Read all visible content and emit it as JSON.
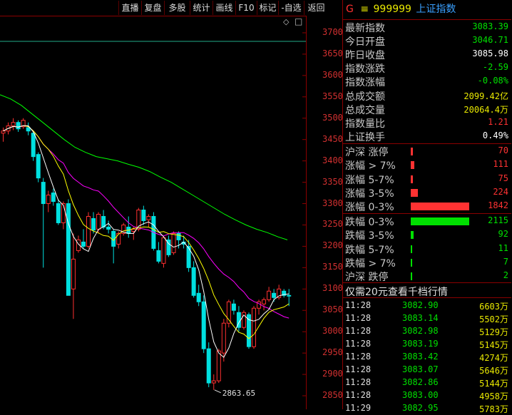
{
  "toolbar": {
    "buttons": [
      "直播",
      "复盘",
      "多股",
      "统计",
      "画线",
      "F10",
      "标记",
      "-自选",
      "返回"
    ]
  },
  "header": {
    "g_label": "G",
    "menu_glyph": "≡",
    "code": "999999",
    "name": "上证指数"
  },
  "chart_icons": {
    "diamond": "◇",
    "box": "□"
  },
  "colors": {
    "up": "#ff3030",
    "down": "#00e0e0",
    "ma5": "#ffffff",
    "ma10": "#ffff00",
    "ma20": "#ff00ff",
    "ma60": "#00ff00",
    "value_yellow": "#e8e800",
    "value_red": "#ff3232",
    "value_green": "#00e000",
    "value_white": "#ffffff",
    "accent_blue": "#3aa0ff"
  },
  "stats": [
    {
      "label": "最新指数",
      "value": "3083.39",
      "color": "#00e000"
    },
    {
      "label": "今日开盘",
      "value": "3046.71",
      "color": "#00e000"
    },
    {
      "label": "昨日收盘",
      "value": "3085.98",
      "color": "#ffffff"
    },
    {
      "label": "指数涨跌",
      "value": "-2.59",
      "color": "#00e000"
    },
    {
      "label": "指数涨幅",
      "value": "-0.08%",
      "color": "#00e000"
    },
    {
      "label": "总成交额",
      "value": "2099.42亿",
      "color": "#e8e800"
    },
    {
      "label": "总成交量",
      "value": "20064.4万",
      "color": "#e8e800"
    },
    {
      "label": "指数量比",
      "value": "1.21",
      "color": "#ff3232"
    },
    {
      "label": "上证换手",
      "value": "0.49%",
      "color": "#ffffff"
    }
  ],
  "dist_up": [
    {
      "label": "沪深 涨停",
      "value": "70",
      "share": 0.038
    },
    {
      "label": "涨幅 > 7%",
      "value": "111",
      "share": 0.06
    },
    {
      "label": "涨幅 5-7%",
      "value": "75",
      "share": 0.041
    },
    {
      "label": "涨幅 3-5%",
      "value": "224",
      "share": 0.122
    },
    {
      "label": "涨幅 0-3%",
      "value": "1842",
      "share": 1.0
    }
  ],
  "dist_down": [
    {
      "label": "跌幅 0-3%",
      "value": "2115",
      "share": 1.0
    },
    {
      "label": "跌幅 3-5%",
      "value": "92",
      "share": 0.043
    },
    {
      "label": "跌幅 5-7%",
      "value": "11",
      "share": 0.005
    },
    {
      "label": "跌幅 > 7%",
      "value": "7",
      "share": 0.003
    },
    {
      "label": "沪深 跌停",
      "value": "2",
      "share": 0.001
    }
  ],
  "promo": "仅需20元查看千档行情",
  "ticks": [
    {
      "time": "11:28",
      "price": "3082.90",
      "vol": "6603万"
    },
    {
      "time": "11:28",
      "price": "3083.14",
      "vol": "5502万"
    },
    {
      "time": "11:28",
      "price": "3082.98",
      "vol": "5129万"
    },
    {
      "time": "11:28",
      "price": "3083.19",
      "vol": "5145万"
    },
    {
      "time": "11:28",
      "price": "3083.42",
      "vol": "4274万"
    },
    {
      "time": "11:28",
      "price": "3083.07",
      "vol": "5646万"
    },
    {
      "time": "11:28",
      "price": "3082.86",
      "vol": "5144万"
    },
    {
      "time": "11:28",
      "price": "3083.00",
      "vol": "4958万"
    },
    {
      "time": "11:29",
      "price": "3082.95",
      "vol": "5783万"
    }
  ],
  "chart_data": {
    "type": "candlestick",
    "y_ticks": [
      3700,
      3650,
      3600,
      3550,
      3500,
      3450,
      3400,
      3350,
      3300,
      3250,
      3200,
      3150,
      3100,
      3050,
      3000,
      2950,
      2900,
      2850
    ],
    "ylim": [
      2835,
      3720
    ],
    "low_label": "2863.65",
    "reference_level": 3680,
    "candles": [
      {
        "o": 3465,
        "h": 3478,
        "l": 3445,
        "c": 3470
      },
      {
        "o": 3470,
        "h": 3490,
        "l": 3462,
        "c": 3482
      },
      {
        "o": 3482,
        "h": 3500,
        "l": 3472,
        "c": 3490
      },
      {
        "o": 3490,
        "h": 3495,
        "l": 3468,
        "c": 3475
      },
      {
        "o": 3480,
        "h": 3500,
        "l": 3475,
        "c": 3495
      },
      {
        "o": 3478,
        "h": 3490,
        "l": 3460,
        "c": 3470
      },
      {
        "o": 3465,
        "h": 3470,
        "l": 3400,
        "c": 3410
      },
      {
        "o": 3415,
        "h": 3420,
        "l": 3350,
        "c": 3360
      },
      {
        "o": 3350,
        "h": 3360,
        "l": 3150,
        "c": 3300
      },
      {
        "o": 3300,
        "h": 3330,
        "l": 3280,
        "c": 3320
      },
      {
        "o": 3325,
        "h": 3335,
        "l": 3295,
        "c": 3305
      },
      {
        "o": 3300,
        "h": 3310,
        "l": 3250,
        "c": 3255
      },
      {
        "o": 3255,
        "h": 3305,
        "l": 3240,
        "c": 3300
      },
      {
        "o": 3300,
        "h": 3310,
        "l": 3180,
        "c": 3085
      },
      {
        "o": 3100,
        "h": 3230,
        "l": 3030,
        "c": 3170
      },
      {
        "o": 3190,
        "h": 3225,
        "l": 3185,
        "c": 3215
      },
      {
        "o": 3210,
        "h": 3240,
        "l": 3195,
        "c": 3200
      },
      {
        "o": 3200,
        "h": 3280,
        "l": 3195,
        "c": 3270
      },
      {
        "o": 3265,
        "h": 3280,
        "l": 3230,
        "c": 3238
      },
      {
        "o": 3240,
        "h": 3280,
        "l": 3230,
        "c": 3275
      },
      {
        "o": 3270,
        "h": 3285,
        "l": 3240,
        "c": 3245
      },
      {
        "o": 3245,
        "h": 3260,
        "l": 3230,
        "c": 3240
      },
      {
        "o": 3235,
        "h": 3240,
        "l": 3160,
        "c": 3200
      },
      {
        "o": 3205,
        "h": 3235,
        "l": 3195,
        "c": 3230
      },
      {
        "o": 3230,
        "h": 3255,
        "l": 3225,
        "c": 3250
      },
      {
        "o": 3245,
        "h": 3270,
        "l": 3220,
        "c": 3230
      },
      {
        "o": 3235,
        "h": 3245,
        "l": 3215,
        "c": 3240
      },
      {
        "o": 3240,
        "h": 3290,
        "l": 3235,
        "c": 3285
      },
      {
        "o": 3285,
        "h": 3295,
        "l": 3250,
        "c": 3260
      },
      {
        "o": 3262,
        "h": 3275,
        "l": 3245,
        "c": 3270
      },
      {
        "o": 3270,
        "h": 3280,
        "l": 3190,
        "c": 3195
      },
      {
        "o": 3190,
        "h": 3210,
        "l": 3160,
        "c": 3165
      },
      {
        "o": 3160,
        "h": 3225,
        "l": 3150,
        "c": 3220
      },
      {
        "o": 3215,
        "h": 3225,
        "l": 3175,
        "c": 3180
      },
      {
        "o": 3185,
        "h": 3235,
        "l": 3180,
        "c": 3230
      },
      {
        "o": 3230,
        "h": 3235,
        "l": 3195,
        "c": 3215
      },
      {
        "o": 3210,
        "h": 3225,
        "l": 3195,
        "c": 3205
      },
      {
        "o": 3200,
        "h": 3215,
        "l": 3140,
        "c": 3150
      },
      {
        "o": 3150,
        "h": 3165,
        "l": 3080,
        "c": 3085
      },
      {
        "o": 3090,
        "h": 3110,
        "l": 3060,
        "c": 3070
      },
      {
        "o": 3070,
        "h": 3085,
        "l": 2950,
        "c": 2960
      },
      {
        "o": 2960,
        "h": 2975,
        "l": 2870,
        "c": 2880
      },
      {
        "o": 2880,
        "h": 2900,
        "l": 2863.65,
        "c": 2885
      },
      {
        "o": 2885,
        "h": 2960,
        "l": 2880,
        "c": 2955
      },
      {
        "o": 2950,
        "h": 3030,
        "l": 2930,
        "c": 3020
      },
      {
        "o": 3020,
        "h": 3075,
        "l": 3010,
        "c": 3070
      },
      {
        "o": 3065,
        "h": 3075,
        "l": 3040,
        "c": 3050
      },
      {
        "o": 3045,
        "h": 3060,
        "l": 3000,
        "c": 3010
      },
      {
        "o": 3010,
        "h": 3050,
        "l": 3005,
        "c": 3045
      },
      {
        "o": 3040,
        "h": 3045,
        "l": 2960,
        "c": 2965
      },
      {
        "o": 2965,
        "h": 3060,
        "l": 2960,
        "c": 3055
      },
      {
        "o": 3055,
        "h": 3075,
        "l": 3040,
        "c": 3070
      },
      {
        "o": 3065,
        "h": 3080,
        "l": 3050,
        "c": 3075
      },
      {
        "o": 3075,
        "h": 3105,
        "l": 3070,
        "c": 3095
      },
      {
        "o": 3090,
        "h": 3100,
        "l": 3070,
        "c": 3080
      },
      {
        "o": 3080,
        "h": 3110,
        "l": 3075,
        "c": 3100
      },
      {
        "o": 3095,
        "h": 3100,
        "l": 3080,
        "c": 3085
      },
      {
        "o": 3085,
        "h": 3100,
        "l": 3060,
        "c": 3083.39
      }
    ],
    "ma60": [
      [
        0,
        3555
      ],
      [
        15,
        3545
      ],
      [
        30,
        3530
      ],
      [
        45,
        3510
      ],
      [
        60,
        3490
      ],
      [
        75,
        3470
      ],
      [
        90,
        3450
      ],
      [
        105,
        3432
      ],
      [
        120,
        3420
      ],
      [
        135,
        3410
      ],
      [
        150,
        3405
      ],
      [
        165,
        3400
      ],
      [
        180,
        3392
      ],
      [
        195,
        3385
      ],
      [
        210,
        3375
      ],
      [
        225,
        3362
      ],
      [
        240,
        3350
      ],
      [
        255,
        3335
      ],
      [
        270,
        3320
      ],
      [
        285,
        3305
      ],
      [
        300,
        3290
      ],
      [
        315,
        3275
      ],
      [
        330,
        3262
      ],
      [
        345,
        3250
      ],
      [
        360,
        3240
      ],
      [
        375,
        3232
      ],
      [
        390,
        3222
      ],
      [
        403,
        3215
      ]
    ]
  }
}
